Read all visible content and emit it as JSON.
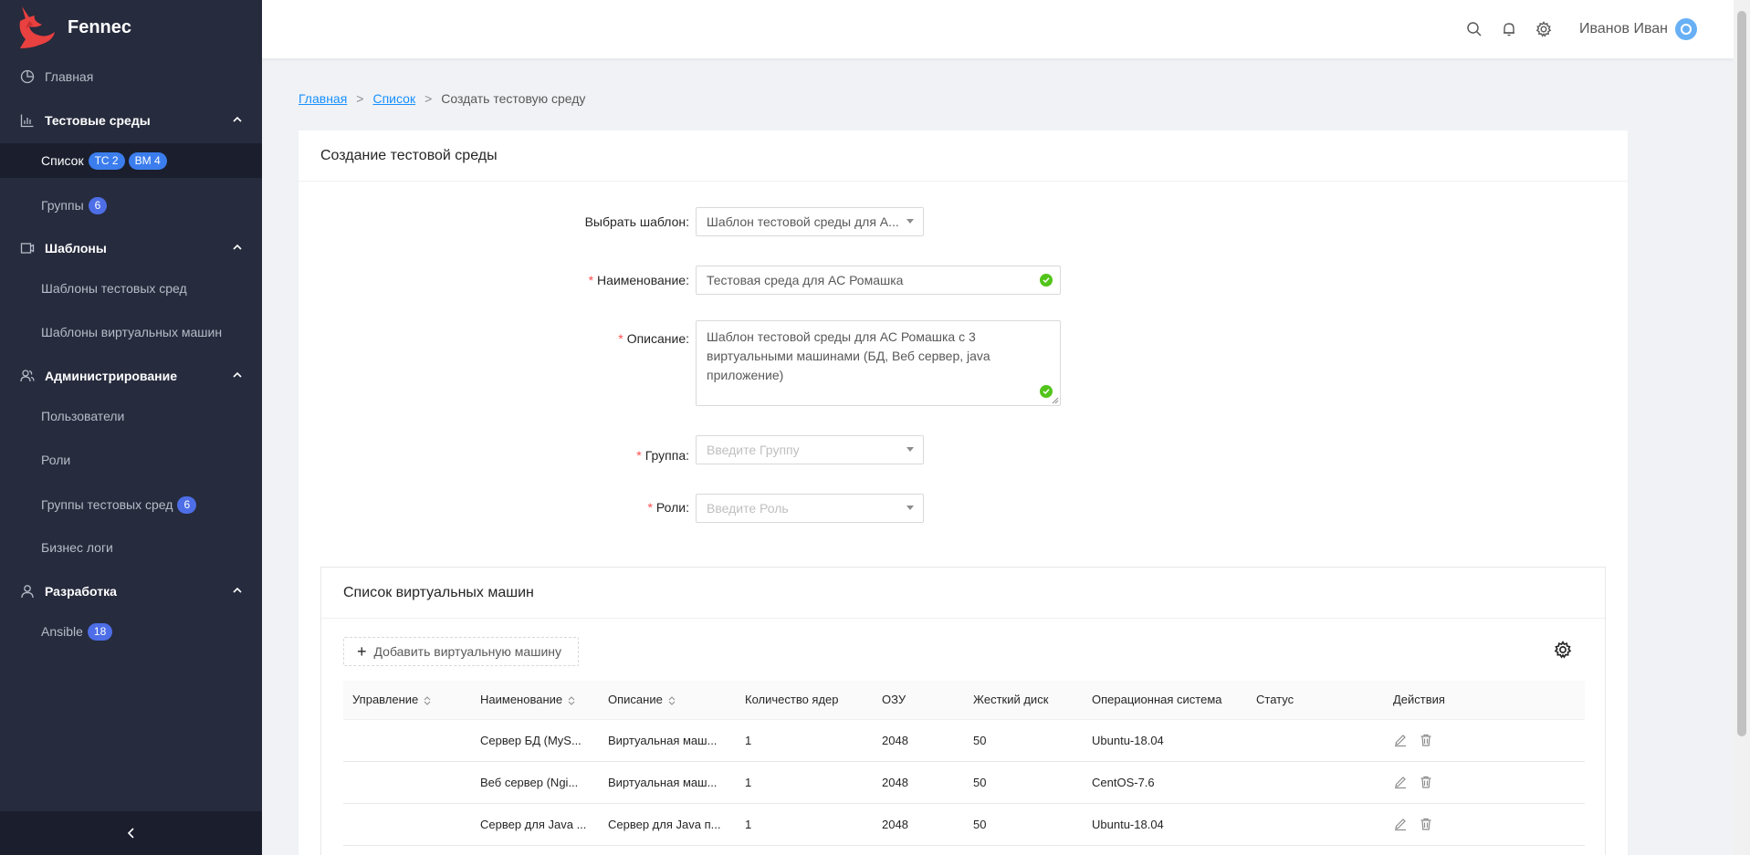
{
  "app": {
    "name": "Fennec"
  },
  "sidebar": {
    "home": "Главная",
    "test_envs": {
      "label": "Тестовые среды",
      "items": [
        {
          "label": "Список",
          "badges": [
            "ТС 2",
            "ВМ 4"
          ]
        },
        {
          "label": "Группы",
          "badge": "6"
        }
      ]
    },
    "templates": {
      "label": "Шаблоны",
      "items": [
        {
          "label": "Шаблоны тестовых сред"
        },
        {
          "label": "Шаблоны виртуальных машин"
        }
      ]
    },
    "admin": {
      "label": "Администрирование",
      "items": [
        {
          "label": "Пользователи"
        },
        {
          "label": "Роли"
        },
        {
          "label": "Группы тестовых сред",
          "badge": "6"
        },
        {
          "label": "Бизнес логи"
        }
      ]
    },
    "dev": {
      "label": "Разработка",
      "items": [
        {
          "label": "Ansible",
          "badge": "18"
        }
      ]
    }
  },
  "header": {
    "user": "Иванов Иван"
  },
  "breadcrumb": {
    "home": "Главная",
    "list": "Список",
    "current": "Создать тестовую среду"
  },
  "form": {
    "title": "Создание тестовой среды",
    "template_label": "Выбрать шаблон",
    "template_value": "Шаблон тестовой среды для А...",
    "name_label": "Наименование",
    "name_value": "Тестовая среда для АС Ромашка",
    "desc_label": "Описание",
    "desc_value": "Шаблон тестовой среды для АС Ромашка с 3 виртуальными машинами (БД, Веб сервер, java приложение)",
    "group_label": "Группа",
    "group_placeholder": "Введите Группу",
    "roles_label": "Роли",
    "roles_placeholder": "Введите Роль"
  },
  "vm_list": {
    "title": "Список виртуальных машин",
    "add_button": "Добавить виртуальную машину",
    "columns": [
      "Управление",
      "Наименование",
      "Описание",
      "Количество ядер",
      "ОЗУ",
      "Жесткий диск",
      "Операционная система",
      "Статус",
      "Действия"
    ],
    "rows": [
      {
        "name": "Сервер БД (MyS...",
        "desc": "Виртуальная маш...",
        "cores": "1",
        "ram": "2048",
        "disk": "50",
        "os": "Ubuntu-18.04",
        "status": ""
      },
      {
        "name": "Веб сервер (Ngi...",
        "desc": "Виртуальная маш...",
        "cores": "1",
        "ram": "2048",
        "disk": "50",
        "os": "CentOS-7.6",
        "status": ""
      },
      {
        "name": "Сервер для Java ...",
        "desc": "Сервер для Java п...",
        "cores": "1",
        "ram": "2048",
        "disk": "50",
        "os": "Ubuntu-18.04",
        "status": ""
      }
    ]
  },
  "colors": {
    "sidebar_bg": "#262b3d",
    "accent": "#1890ff",
    "badge": "#3b7ded",
    "success": "#52c41a",
    "required": "#ff4d4f"
  }
}
